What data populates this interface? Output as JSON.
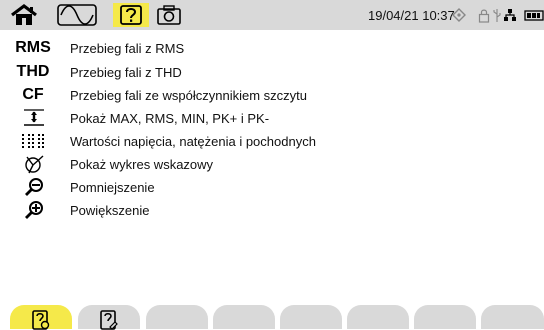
{
  "header": {
    "datetime": "19/04/21 10:37",
    "colors": {
      "bar": "#d9d9d9",
      "highlight": "#f5e94a"
    },
    "icons": [
      "home-icon",
      "waveform-icon",
      "help-icon",
      "camera-icon",
      "signal-icon",
      "lock-icon",
      "usb-icon",
      "network-icon",
      "battery-icon"
    ]
  },
  "help_items": [
    {
      "abbr": "RMS",
      "label": "Przebieg fali z RMS"
    },
    {
      "abbr": "THD",
      "label": "Przebieg fali z THD"
    },
    {
      "abbr": "CF",
      "label": "Przebieg fali ze współczynnikiem szczytu"
    },
    {
      "icon": "max-min-icon",
      "label": "Pokaż MAX, RMS, MIN, PK+ i PK-"
    },
    {
      "icon": "grid-values-icon",
      "label": "Wartości napięcia, natężenia i pochodnych"
    },
    {
      "icon": "phasor-icon",
      "label": "Pokaż wykres wskazowy"
    },
    {
      "icon": "zoom-out-icon",
      "label": "Pomniejszenie"
    },
    {
      "icon": "zoom-in-icon",
      "label": "Powiększenie"
    }
  ],
  "bottom_tabs": [
    {
      "icon": "help-page-icon",
      "active": true
    },
    {
      "icon": "help-page-2-icon",
      "active": false
    }
  ]
}
